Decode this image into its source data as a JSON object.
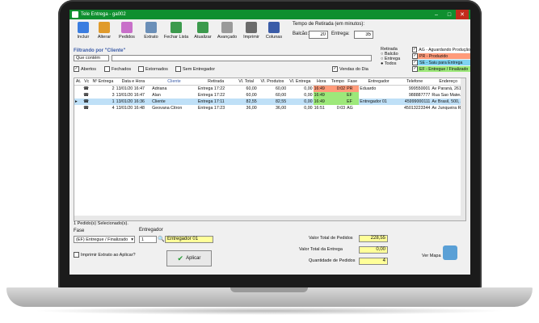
{
  "window": {
    "title": "Tele Entrega - ga002",
    "minimize": "–",
    "maximize": "□",
    "close": "✕"
  },
  "toolbar": {
    "buttons": [
      {
        "label": "Incluir",
        "icon": "add-icon",
        "color": "#3b7de0"
      },
      {
        "label": "Alterar",
        "icon": "edit-icon",
        "color": "#e09a2b"
      },
      {
        "label": "Pedidos",
        "icon": "orders-icon",
        "color": "#c86fc9"
      },
      {
        "label": "Extrato",
        "icon": "printer-icon",
        "color": "#6b8fb8"
      },
      {
        "label": "Fechar Lista",
        "icon": "close-list-icon",
        "color": "#3c9a4d"
      },
      {
        "label": "Atualizar",
        "icon": "refresh-icon",
        "color": "#3c9a4d"
      },
      {
        "label": "Avançado",
        "icon": "advanced-icon",
        "color": "#9a9a9a"
      },
      {
        "label": "Imprimir",
        "icon": "print-icon",
        "color": "#6b6b6b"
      },
      {
        "label": "Colunas",
        "icon": "columns-icon",
        "color": "#3b5ca8"
      }
    ]
  },
  "retirada": {
    "title": "Tempo de Retirada (em minutos):",
    "balcao_label": "Balcão:",
    "balcao_value": "20",
    "entrega_label": "Entrega:",
    "entrega_value": "35"
  },
  "filter": {
    "title": "Filtrando por \"Cliente\"",
    "mode": "Que contém",
    "query": ""
  },
  "checks": {
    "abertos": "Abertos",
    "fechados": "Fechados",
    "estornados": "Estornados",
    "sem_entregador": "Sem Entregador",
    "vendas_dia": "Vendas do Dia"
  },
  "retirada_filter": {
    "title": "Retirada",
    "options": [
      "Balcão",
      "Entrega",
      "Todos"
    ]
  },
  "legend": [
    {
      "label": "AG - Aguardando Produção",
      "color": "#ffffff"
    },
    {
      "label": "PR - Produzido",
      "color": "#ff9b7a"
    },
    {
      "label": "SE - Saiu para Entrega",
      "color": "#7fd3f0"
    },
    {
      "label": "EF - Entregue / Finalizado",
      "color": "#9de87a"
    }
  ],
  "grid": {
    "headers": [
      "At.",
      "Vc",
      "Nº Entrega",
      "Data e Hora",
      "Cliente",
      "Retirada",
      "Vl. Total",
      "Vl. Produtos",
      "Vl. Entrega",
      "Hora",
      "Tempo",
      "Fase",
      "Entregador",
      "Telefone",
      "Endereço"
    ],
    "rows": [
      {
        "num": "2",
        "data": "13/01/20 16:47",
        "cliente": "Adriana",
        "retirada": "Entrega 17:22",
        "total": "60,00",
        "produtos": "60,00",
        "entrega": "0,00",
        "hora": "16:49",
        "tempo": "0:02",
        "fase": "PR",
        "entregador": "Eduardo",
        "telefone": "999550001",
        "endereco": "Av Paraná, 261"
      },
      {
        "num": "3",
        "data": "13/01/20 16:47",
        "cliente": "Alan",
        "retirada": "Entrega 17:22",
        "total": "60,00",
        "produtos": "60,00",
        "entrega": "0,00",
        "hora": "16:49",
        "tempo": "",
        "fase": "EF",
        "entregador": "",
        "telefone": "988887777",
        "endereco": "Rua Sao Mateus"
      },
      {
        "num": "1",
        "data": "13/01/20 16:36",
        "cliente": "Cliente",
        "retirada": "Entrega 17:11",
        "total": "82,55",
        "produtos": "82,55",
        "entrega": "0,00",
        "hora": "16:49",
        "tempo": "",
        "fase": "EF",
        "entregador": "Entregador 01",
        "telefone": "45999000111",
        "endereco": "Av Brasil, 500, A"
      },
      {
        "num": "4",
        "data": "13/01/20 16:48",
        "cliente": "Geovana Citron",
        "retirada": "Entrega 17:23",
        "total": "36,00",
        "produtos": "36,00",
        "entrega": "0,00",
        "hora": "16:51",
        "tempo": "0:03",
        "fase": "AG",
        "entregador": "",
        "telefone": "45013223344",
        "endereco": "Av Junqueira Rey"
      }
    ]
  },
  "bottom": {
    "selected_text": "1 Pedido(s) Selecionado(s).",
    "fase_label": "Fase",
    "fase_value": "(EF) Entregue / Finalizado",
    "entregador_label": "Entregador",
    "entregador_id": "1",
    "entregador_name": "Entregador 01",
    "imprimir_extrato": "Imprimir Extrato ao Aplicar?",
    "aplicar": "Aplicar",
    "total_pedidos_label": "Valor Total de Pedidos",
    "total_pedidos": "228,55",
    "total_entrega_label": "Valor Total da Entrega",
    "total_entrega": "0,00",
    "qtd_label": "Quantidade de Pedidos",
    "qtd": "4",
    "ver_mapa": "Ver Mapa"
  }
}
